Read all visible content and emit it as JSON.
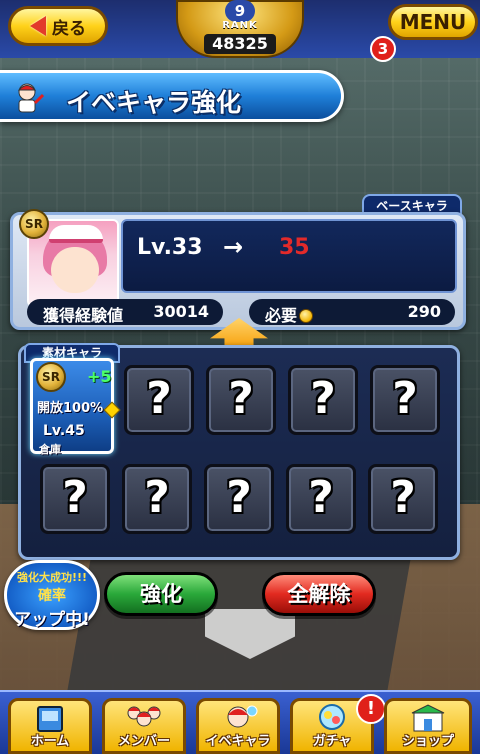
{
  "header": {
    "back_label": "戻る",
    "rank_label": "RANK",
    "rank_value": "9",
    "rank_points": "48325",
    "menu_label": "MENU",
    "menu_badge": "3"
  },
  "title": "イベキャラ強化",
  "base_chara": {
    "tag": "ベースキャラ",
    "rarity": "SR",
    "level_current": "Lv.33",
    "level_arrow": "→",
    "level_next": "35",
    "exp_label": "獲得経験値",
    "exp_value": "30014",
    "required_label": "必要",
    "required_value": "290"
  },
  "material": {
    "tag": "素材キャラ",
    "card": {
      "rarity": "SR",
      "plus": "+5",
      "open": "開放100%",
      "level": "Lv.45",
      "location": "倉庫"
    },
    "empty_slot_symbol": "?"
  },
  "promo": {
    "line1": "強化大成功!!!",
    "line2": "確率",
    "line3": "アップ中!"
  },
  "actions": {
    "enhance": "強化",
    "release_all": "全解除"
  },
  "bottom_nav": {
    "items": [
      {
        "label": "ホーム",
        "icon": "home-icon"
      },
      {
        "label": "メンバー",
        "icon": "team-icon"
      },
      {
        "label": "イベキャラ",
        "icon": "event-chara-icon"
      },
      {
        "label": "ガチャ",
        "icon": "gacha-icon"
      },
      {
        "label": "ショップ",
        "icon": "shop-icon"
      }
    ],
    "gacha_alert": "!"
  },
  "colors": {
    "level_next": "#e22a2a",
    "enhance_button": "#2aa83a",
    "release_button": "#e22a20",
    "title_banner": "#1f7fd8"
  }
}
